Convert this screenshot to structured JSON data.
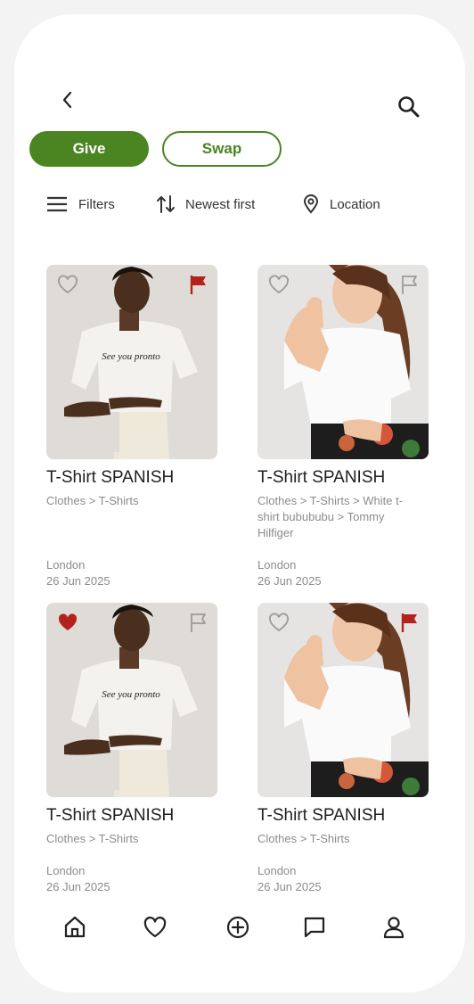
{
  "header": {
    "back_icon": "chevron-left-icon",
    "search_icon": "search-icon"
  },
  "mode_tabs": {
    "give_label": "Give",
    "swap_label": "Swap",
    "active": "Give",
    "accent": "#4a8522"
  },
  "toolbar": {
    "filters_label": "Filters",
    "sort_label": "Newest first",
    "location_label": "Location"
  },
  "items": [
    {
      "title": "T-Shirt SPANISH",
      "category": "Clothes > T-Shirts",
      "location": "London",
      "date": "26 Jun 2025",
      "liked": false,
      "flagged": true,
      "shirt_text": "See you pronto"
    },
    {
      "title": "T-Shirt SPANISH",
      "category": "Clothes > T-Shirts > White t-shirt bubububu > Tommy Hilfiger",
      "location": "London",
      "date": "26 Jun 2025",
      "liked": false,
      "flagged": false
    },
    {
      "title": "T-Shirt SPANISH",
      "category": "Clothes > T-Shirts",
      "location": "London",
      "date": "26 Jun 2025",
      "liked": true,
      "flagged": false,
      "shirt_text": "See you pronto"
    },
    {
      "title": "T-Shirt SPANISH",
      "category": "Clothes > T-Shirts",
      "location": "London",
      "date": "26 Jun 2025",
      "liked": false,
      "flagged": true
    }
  ],
  "bottom_nav": [
    "home-icon",
    "heart-icon",
    "add-circle-icon",
    "chat-icon",
    "profile-icon"
  ],
  "colors": {
    "flag_active": "#b3221c",
    "heart_active": "#b3221c",
    "icon_inactive": "#9a9a9a"
  }
}
